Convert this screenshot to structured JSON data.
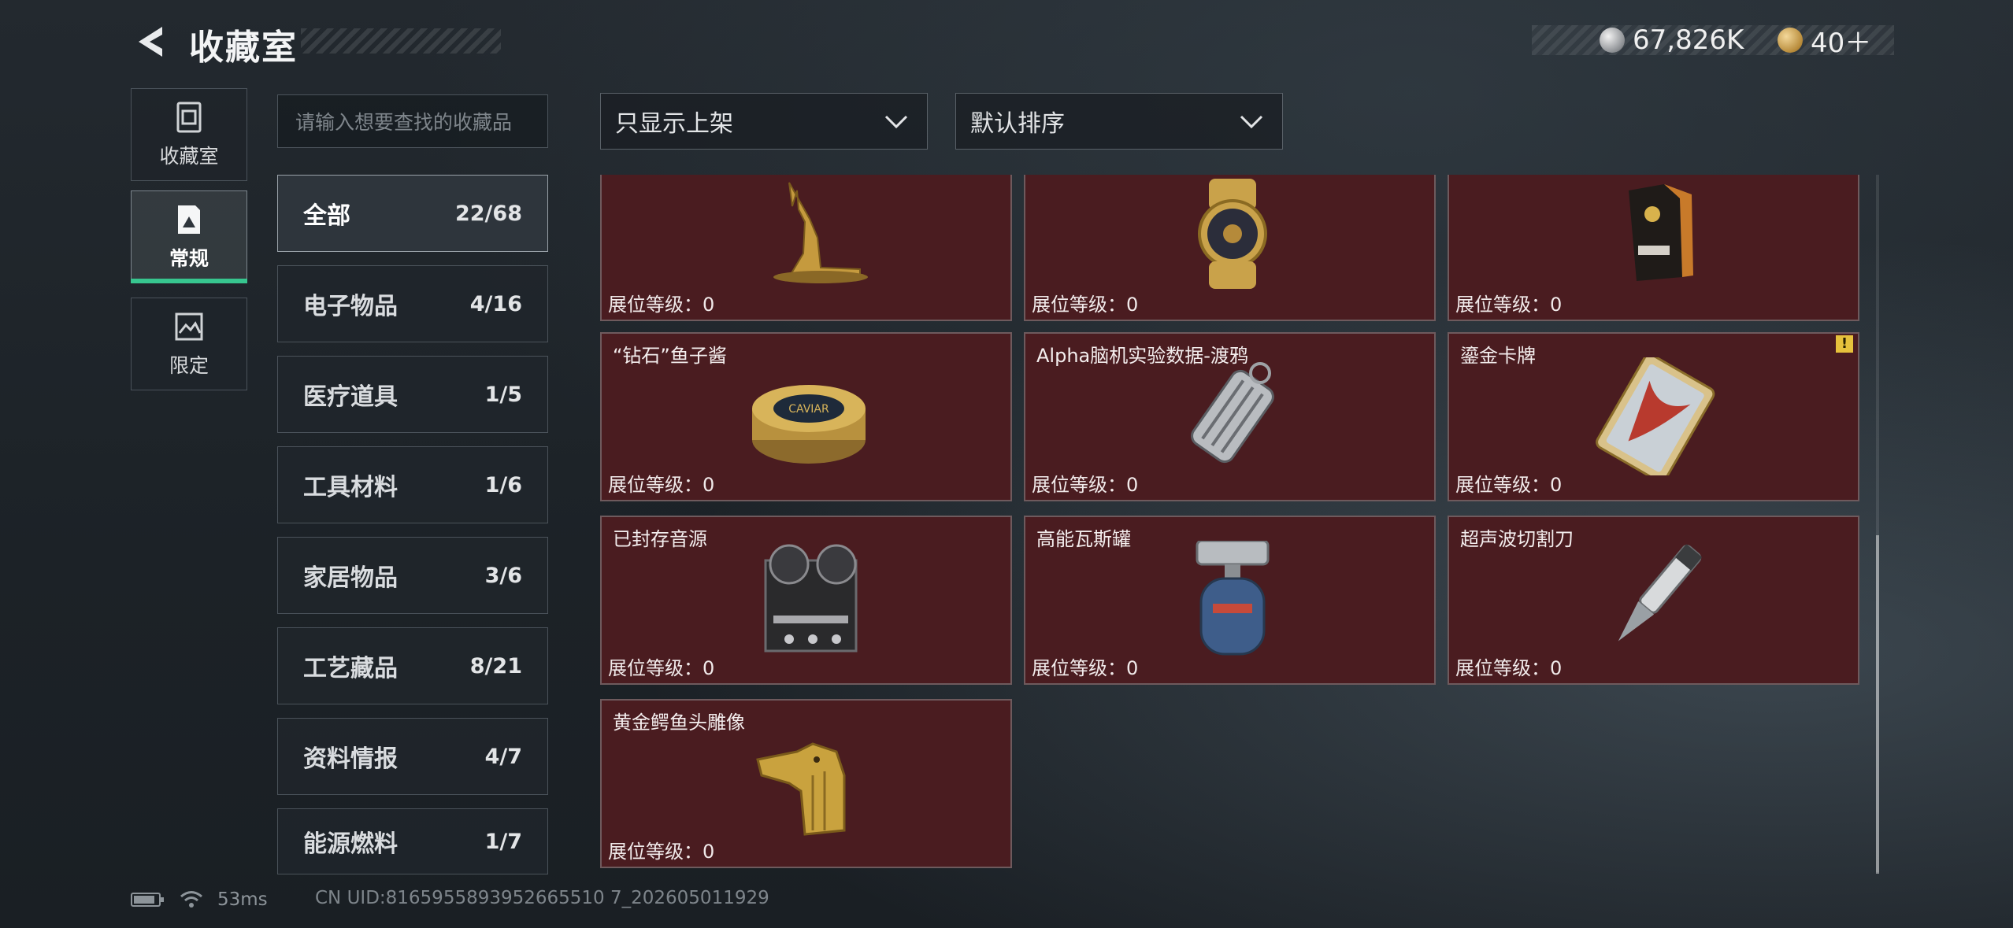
{
  "header": {
    "title": "收藏室",
    "currency_silver": "67,826K",
    "currency_gold": "40＋"
  },
  "rail": [
    {
      "label": "收藏室",
      "icon": "trash-bin-icon",
      "active": false
    },
    {
      "label": "常规",
      "icon": "document-icon",
      "active": true
    },
    {
      "label": "限定",
      "icon": "picture-icon",
      "active": false
    }
  ],
  "search": {
    "placeholder": "请输入想要查找的收藏品"
  },
  "filters": {
    "listing": "只显示上架",
    "sort": "默认排序"
  },
  "categories": [
    {
      "label": "全部",
      "count": "22/68"
    },
    {
      "label": "电子物品",
      "count": "4/16"
    },
    {
      "label": "医疗道具",
      "count": "1/5"
    },
    {
      "label": "工具材料",
      "count": "1/6"
    },
    {
      "label": "家居物品",
      "count": "3/6"
    },
    {
      "label": "工艺藏品",
      "count": "8/21"
    },
    {
      "label": "资料情报",
      "count": "4/7"
    },
    {
      "label": "能源燃料",
      "count": "1/7"
    }
  ],
  "items": [
    {
      "name": "",
      "level": "展位等级：0",
      "icon": "golden-deer-statue-icon"
    },
    {
      "name": "",
      "level": "展位等级：0",
      "icon": "gold-watch-icon"
    },
    {
      "name": "",
      "level": "展位等级：0",
      "icon": "coffee-bag-icon"
    },
    {
      "name": "“钻石”鱼子酱",
      "level": "展位等级：0",
      "icon": "caviar-tin-icon"
    },
    {
      "name": "Alpha脑机实验数据-渡鸦",
      "level": "展位等级：0",
      "icon": "data-drive-icon"
    },
    {
      "name": "鎏金卡牌",
      "level": "展位等级：0",
      "icon": "gilded-card-icon",
      "warning": "!"
    },
    {
      "name": "已封存音源",
      "level": "展位等级：0",
      "icon": "reel-tape-recorder-icon"
    },
    {
      "name": "高能瓦斯罐",
      "level": "展位等级：0",
      "icon": "gas-canister-icon"
    },
    {
      "name": "超声波切割刀",
      "level": "展位等级：0",
      "icon": "ultrasonic-cutter-icon"
    },
    {
      "name": "黄金鳄鱼头雕像",
      "level": "展位等级：0",
      "icon": "golden-crocodile-head-icon"
    }
  ],
  "status": {
    "ping": "53ms",
    "uid": "CN UID:8165955893952665510 7_202605011929"
  }
}
